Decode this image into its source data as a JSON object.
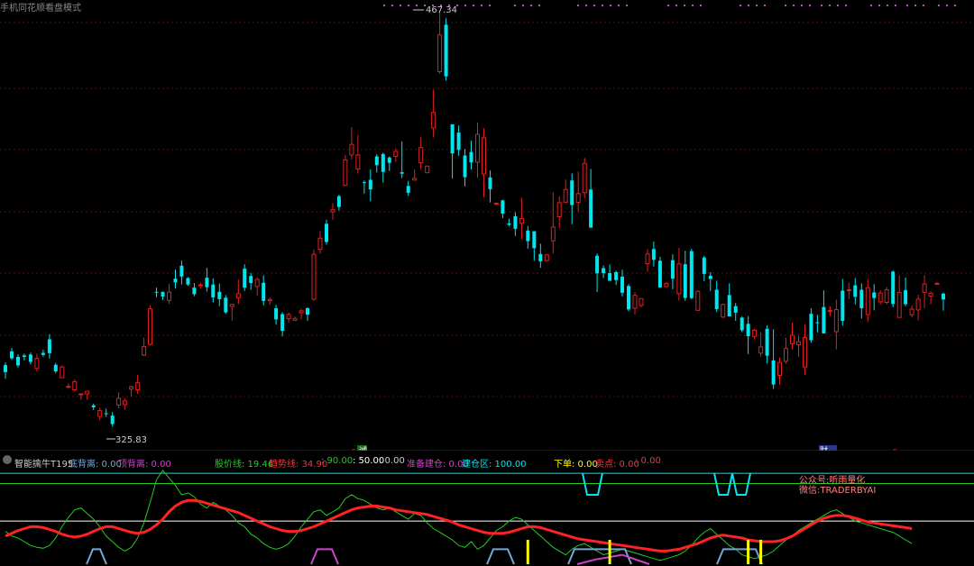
{
  "header": {
    "title": "手机同花顺看盘模式"
  },
  "chart_data": {
    "type": "candlestick",
    "price_range": [
      320,
      470
    ],
    "annotations": {
      "high_label": "467.34",
      "low_label": "325.83",
      "high_value": 467.34,
      "low_value": 325.83
    },
    "candles": [
      [
        346.7,
        344.3,
        347.6,
        342.0
      ],
      [
        351.4,
        349.0,
        352.5,
        348.5
      ],
      [
        349.5,
        346.6,
        350.4,
        345.9
      ],
      [
        350.0,
        349.5,
        350.6,
        348.3
      ],
      [
        350.3,
        347.8,
        351.0,
        346.9
      ],
      [
        345.6,
        349.0,
        350.6,
        344.6
      ],
      [
        350.9,
        350.2,
        352.0,
        349.5
      ],
      [
        355.5,
        350.8,
        357.3,
        349.0
      ],
      [
        346.8,
        344.6,
        347.5,
        343.9
      ],
      [
        342.4,
        346.1,
        346.6,
        342.4
      ],
      [
        339.3,
        339.5,
        340.5,
        338.8
      ],
      [
        338.3,
        341.0,
        341.9,
        337.6
      ],
      [
        336.6,
        336.9,
        337.1,
        334.9
      ],
      [
        336.9,
        337.8,
        337.8,
        334.9
      ],
      [
        333.0,
        332.3,
        333.6,
        331.4
      ],
      [
        329.2,
        331.2,
        332.2,
        328.0
      ],
      [
        330.3,
        330.0,
        331.9,
        329.0
      ],
      [
        329.5,
        326.6,
        330.7,
        325.8
      ],
      [
        333.1,
        335.4,
        337.5,
        332.0
      ],
      [
        333.2,
        334.5,
        335.4,
        331.5
      ],
      [
        338.5,
        339.3,
        339.7,
        335.9
      ],
      [
        338.3,
        340.7,
        343.3,
        336.8
      ],
      [
        350.1,
        353.0,
        356.1,
        349.8
      ],
      [
        353.8,
        365.9,
        367.1,
        353.4
      ],
      [
        371.7,
        371.5,
        373.1,
        369.9
      ],
      [
        371.7,
        370.1,
        371.7,
        368.9
      ],
      [
        368.8,
        371.6,
        374.4,
        367.6
      ],
      [
        376.2,
        374.9,
        379.3,
        372.8
      ],
      [
        380.6,
        376.9,
        382.4,
        374.2
      ],
      [
        376.4,
        374.2,
        376.7,
        373.8
      ],
      [
        373.1,
        370.9,
        374.7,
        370.2
      ],
      [
        374.0,
        374.1,
        374.8,
        372.8
      ],
      [
        376.5,
        373.3,
        379.9,
        371.8
      ],
      [
        374.2,
        369.8,
        376.3,
        368.1
      ],
      [
        371.7,
        369.2,
        374.5,
        366.8
      ],
      [
        369.7,
        364.7,
        370.6,
        364.2
      ],
      [
        366.7,
        367.4,
        367.6,
        361.9
      ],
      [
        369.7,
        371.1,
        375.9,
        367.5
      ],
      [
        379.6,
        373.1,
        381.1,
        372.0
      ],
      [
        377.1,
        374.7,
        378.2,
        372.4
      ],
      [
        373.5,
        375.9,
        376.7,
        370.4
      ],
      [
        374.8,
        368.6,
        377.3,
        367.1
      ],
      [
        368.7,
        369.1,
        369.8,
        367.3
      ],
      [
        366.1,
        362.3,
        367.2,
        360.5
      ],
      [
        364.1,
        358.4,
        364.8,
        356.5
      ],
      [
        362.6,
        364.0,
        364.7,
        361.2
      ],
      [
        362.0,
        362.6,
        363.2,
        362.3
      ],
      [
        364.6,
        365.2,
        365.9,
        362.3
      ],
      [
        366.1,
        363.9,
        366.4,
        361.8
      ],
      [
        369.2,
        384.5,
        386.1,
        368.6
      ],
      [
        386.2,
        390.0,
        392.4,
        384.7
      ],
      [
        394.9,
        388.7,
        396.3,
        387.8
      ],
      [
        399.0,
        399.7,
        402.0,
        396.3
      ],
      [
        404.3,
        400.6,
        404.8,
        399.4
      ],
      [
        408.0,
        416.7,
        418.4,
        407.8
      ],
      [
        418.4,
        422.0,
        427.9,
        416.8
      ],
      [
        413.6,
        418.4,
        425.2,
        412.0
      ],
      [
        409.1,
        409.0,
        409.7,
        405.2
      ],
      [
        409.9,
        406.6,
        413.4,
        402.6
      ],
      [
        417.9,
        414.9,
        418.6,
        412.4
      ],
      [
        418.7,
        412.6,
        419.2,
        409.0
      ],
      [
        417.5,
        415.7,
        417.9,
        412.9
      ],
      [
        417.9,
        419.6,
        420.6,
        416.0
      ],
      [
        412.5,
        412.0,
        423.0,
        410.5
      ],
      [
        407.8,
        405.5,
        409.5,
        404.5
      ],
      [
        409.8,
        410.4,
        413.4,
        409.7
      ],
      [
        415.7,
        420.9,
        424.4,
        413.3
      ],
      [
        412.3,
        414.6,
        414.6,
        412.3
      ],
      [
        427.6,
        432.9,
        440.7,
        424.4
      ],
      [
        446.8,
        459.3,
        467.3,
        446.1
      ],
      [
        462.8,
        445.2,
        465.0,
        443.8
      ],
      [
        428.8,
        418.9,
        428.8,
        410.3
      ],
      [
        426.0,
        420.1,
        428.4,
        418.1
      ],
      [
        418.2,
        410.8,
        420.4,
        407.7
      ],
      [
        419.4,
        415.8,
        423.2,
        413.4
      ],
      [
        415.9,
        425.4,
        429.5,
        410.6
      ],
      [
        411.9,
        424.2,
        427.5,
        404.0
      ],
      [
        410.7,
        406.7,
        413.1,
        402.2
      ],
      [
        401.9,
        401.9,
        402.2,
        401.8
      ],
      [
        402.9,
        398.4,
        403.1,
        396.8
      ],
      [
        395.0,
        394.6,
        396.6,
        394.1
      ],
      [
        397.5,
        393.2,
        398.8,
        390.8
      ],
      [
        395.1,
        396.7,
        403.8,
        389.7
      ],
      [
        392.6,
        389.0,
        394.2,
        386.4
      ],
      [
        392.4,
        386.6,
        392.4,
        382.3
      ],
      [
        384.6,
        382.1,
        388.1,
        379.9
      ],
      [
        382.4,
        384.3,
        384.6,
        381.9
      ],
      [
        389.1,
        393.8,
        405.8,
        384.8
      ],
      [
        397.3,
        402.1,
        404.2,
        393.5
      ],
      [
        402.3,
        406.6,
        410.0,
        402.2
      ],
      [
        409.7,
        401.3,
        412.1,
        394.8
      ],
      [
        402.2,
        405.2,
        412.7,
        399.1
      ],
      [
        405.5,
        415.5,
        417.4,
        403.5
      ],
      [
        406.6,
        393.6,
        413.6,
        393.6
      ],
      [
        384.0,
        378.0,
        384.8,
        371.6
      ],
      [
        379.8,
        378.1,
        380.7,
        376.4
      ],
      [
        378.1,
        375.5,
        381.0,
        375.4
      ],
      [
        378.4,
        375.7,
        378.9,
        374.0
      ],
      [
        376.9,
        371.4,
        379.3,
        370.2
      ],
      [
        373.7,
        365.7,
        374.3,
        365.1
      ],
      [
        366.1,
        370.5,
        371.7,
        364.0
      ],
      [
        367.1,
        369.4,
        369.5,
        366.4
      ],
      [
        381.3,
        384.6,
        386.2,
        378.6
      ],
      [
        386.3,
        382.6,
        388.8,
        380.3
      ],
      [
        382.3,
        373.2,
        383.7,
        373.1
      ],
      [
        373.5,
        374.5,
        375.1,
        373.2
      ],
      [
        382.5,
        376.2,
        384.5,
        372.6
      ],
      [
        371.1,
        381.2,
        386.7,
        368.7
      ],
      [
        381.1,
        369.6,
        385.7,
        368.6
      ],
      [
        385.6,
        369.6,
        386.4,
        369.2
      ],
      [
        365.4,
        371.9,
        372.3,
        365.4
      ],
      [
        383.4,
        377.8,
        383.9,
        375.4
      ],
      [
        377.2,
        376.1,
        378.4,
        372.0
      ],
      [
        372.4,
        365.8,
        375.5,
        364.8
      ],
      [
        363.1,
        367.4,
        367.7,
        362.7
      ],
      [
        370.6,
        363.3,
        374.6,
        363.3
      ],
      [
        366.8,
        364.6,
        367.9,
        361.8
      ],
      [
        362.9,
        358.6,
        363.3,
        357.9
      ],
      [
        360.8,
        356.6,
        363.4,
        350.5
      ],
      [
        356.5,
        358.6,
        359.1,
        355.4
      ],
      [
        350.8,
        352.9,
        357.9,
        349.6
      ],
      [
        359.1,
        349.9,
        360.3,
        347.3
      ],
      [
        348.3,
        340.1,
        358.9,
        338.6
      ],
      [
        343.2,
        347.6,
        349.3,
        340.0
      ],
      [
        348.0,
        352.4,
        356.1,
        347.2
      ],
      [
        354.0,
        356.9,
        361.2,
        352.0
      ],
      [
        353.7,
        354.7,
        356.7,
        349.6
      ],
      [
        346.1,
        356.1,
        360.5,
        343.4
      ],
      [
        364.2,
        355.2,
        366.1,
        354.3
      ],
      [
        361.3,
        361.1,
        363.9,
        357.9
      ],
      [
        366.5,
        357.5,
        372.2,
        357.8
      ],
      [
        365.1,
        365.3,
        366.8,
        363.4
      ],
      [
        358.1,
        365.6,
        369.0,
        352.1
      ],
      [
        372.1,
        361.8,
        376.1,
        360.2
      ],
      [
        372.1,
        372.4,
        374.8,
        369.2
      ],
      [
        373.9,
        370.0,
        376.4,
        367.4
      ],
      [
        372.4,
        366.1,
        374.6,
        362.6
      ],
      [
        363.9,
        373.1,
        376.1,
        361.4
      ],
      [
        371.5,
        369.6,
        374.3,
        365.4
      ],
      [
        368.3,
        371.3,
        372.2,
        367.3
      ],
      [
        368.1,
        372.4,
        373.4,
        367.4
      ],
      [
        378.6,
        367.6,
        379.0,
        366.4
      ],
      [
        363.0,
        371.5,
        377.3,
        363.9
      ],
      [
        372.3,
        367.5,
        376.6,
        366.8
      ],
      [
        363.9,
        365.8,
        367.0,
        362.9
      ],
      [
        365.5,
        369.2,
        370.7,
        362.0
      ],
      [
        371.5,
        374.4,
        377.4,
        366.2
      ],
      [
        370.2,
        371.2,
        371.9,
        367.5
      ],
      [
        374.5,
        374.6,
        374.9,
        374.3
      ],
      [
        371.1,
        369.1,
        371.4,
        365.3
      ]
    ],
    "indicator": {
      "name": "智能擒牛T195",
      "ylim": [
        0,
        100
      ],
      "lines": [
        {
          "name": "底背离",
          "value": "0.00",
          "color": "#6fa8dc"
        },
        {
          "name": "顶背离",
          "value": "0.00",
          "color": "#cc44cc"
        },
        {
          "name": "股价线",
          "value": "19.46",
          "color": "#22cc22"
        },
        {
          "name": "趋势线",
          "value": "34.90",
          "color": "#ff3333"
        },
        {
          "name": "",
          "value": "90.00",
          "color": "#22cc22"
        },
        {
          "name": "",
          "value": "50.00",
          "color": "#ffffff"
        },
        {
          "name": "",
          "value": "0.00",
          "color": "#cccccc"
        },
        {
          "name": "准备建仓",
          "value": "0.00",
          "color": "#cc44cc"
        },
        {
          "name": "建仓区",
          "value": "100.00",
          "color": "#00e5ee"
        },
        {
          "name": "下单",
          "value": "0.00",
          "color": "#ffff00"
        },
        {
          "name": "卖点",
          "value": "0.00",
          "color": "#ff3333"
        },
        {
          "name": "",
          "value": "0.00",
          "color": "#ff3333"
        }
      ],
      "price_line": [
        35,
        30,
        28,
        24,
        20,
        18,
        17,
        20,
        28,
        40,
        50,
        58,
        60,
        54,
        48,
        40,
        30,
        24,
        18,
        14,
        18,
        28,
        44,
        66,
        90,
        100,
        92,
        84,
        74,
        76,
        72,
        64,
        60,
        66,
        62,
        58,
        52,
        44,
        40,
        32,
        28,
        22,
        18,
        16,
        18,
        22,
        30,
        40,
        48,
        56,
        58,
        52,
        56,
        60,
        70,
        74,
        70,
        68,
        64,
        60,
        58,
        60,
        56,
        52,
        48,
        54,
        52,
        44,
        38,
        34,
        30,
        26,
        20,
        18,
        24,
        16,
        20,
        28,
        36,
        40,
        46,
        50,
        48,
        42,
        36,
        30,
        24,
        18,
        14,
        10,
        16,
        20,
        22,
        18,
        14,
        10,
        12,
        14,
        16,
        14,
        12,
        10,
        8,
        6,
        4,
        6,
        8,
        10,
        14,
        20,
        28,
        34,
        38,
        32,
        26,
        20,
        16,
        10,
        8,
        6,
        8,
        10,
        14,
        20,
        26,
        30,
        36,
        40,
        44,
        48,
        52,
        56,
        58,
        54,
        50,
        46,
        44,
        42,
        40,
        38,
        36,
        34,
        30,
        26,
        22
      ],
      "trend_line": [
        30,
        33,
        36,
        38,
        40,
        40,
        39,
        37,
        35,
        32,
        30,
        29,
        30,
        32,
        35,
        38,
        40,
        40,
        38,
        36,
        34,
        33,
        34,
        37,
        42,
        48,
        56,
        62,
        66,
        68,
        68,
        67,
        65,
        63,
        61,
        59,
        57,
        55,
        52,
        49,
        46,
        43,
        40,
        38,
        36,
        35,
        35,
        36,
        38,
        40,
        43,
        46,
        49,
        52,
        55,
        58,
        60,
        61,
        62,
        62,
        61,
        60,
        58,
        57,
        56,
        55,
        54,
        53,
        51,
        49,
        47,
        45,
        42,
        40,
        38,
        36,
        34,
        33,
        33,
        33,
        34,
        36,
        38,
        40,
        40,
        39,
        37,
        35,
        33,
        31,
        29,
        27,
        26,
        25,
        24,
        23,
        22,
        21,
        20,
        19,
        18,
        17,
        16,
        15,
        14,
        14,
        15,
        16,
        18,
        20,
        22,
        25,
        28,
        30,
        31,
        30,
        29,
        28,
        26,
        25,
        24,
        24,
        24,
        25,
        27,
        30,
        34,
        38,
        42,
        46,
        49,
        51,
        52,
        52,
        51,
        49,
        47,
        45,
        44,
        43,
        42,
        41,
        40,
        39,
        38
      ],
      "buy_signals_at": [
        83,
        96,
        118,
        120
      ]
    }
  },
  "legend": {
    "indicator_name": "智能擒牛T195",
    "l1": "底背离: 0.00",
    "l2": "顶背离: 0.00",
    "l3": "股价线: 19.46",
    "l4": "趋势线: 34.90",
    "l5": ": 90.00",
    "l6": ": 50.00",
    "l7": ": 0.00",
    "l8": "准备建仓: 0.00",
    "l9": "建仓区: 100.00",
    "l10": "下单: 0.00",
    "l11": "卖点: 0.00",
    "l12": ": 0.00"
  },
  "markers": {
    "m1": "诚",
    "m2": "财",
    "m3": "s",
    "m4": "s"
  },
  "watermark": {
    "line1": "公众号:听雨量化",
    "line2": "微信:TRADERBYAI"
  },
  "colors": {
    "up": "#e02020",
    "down": "#00e5ee",
    "grid": "#5a1010",
    "bg": "#000000"
  }
}
